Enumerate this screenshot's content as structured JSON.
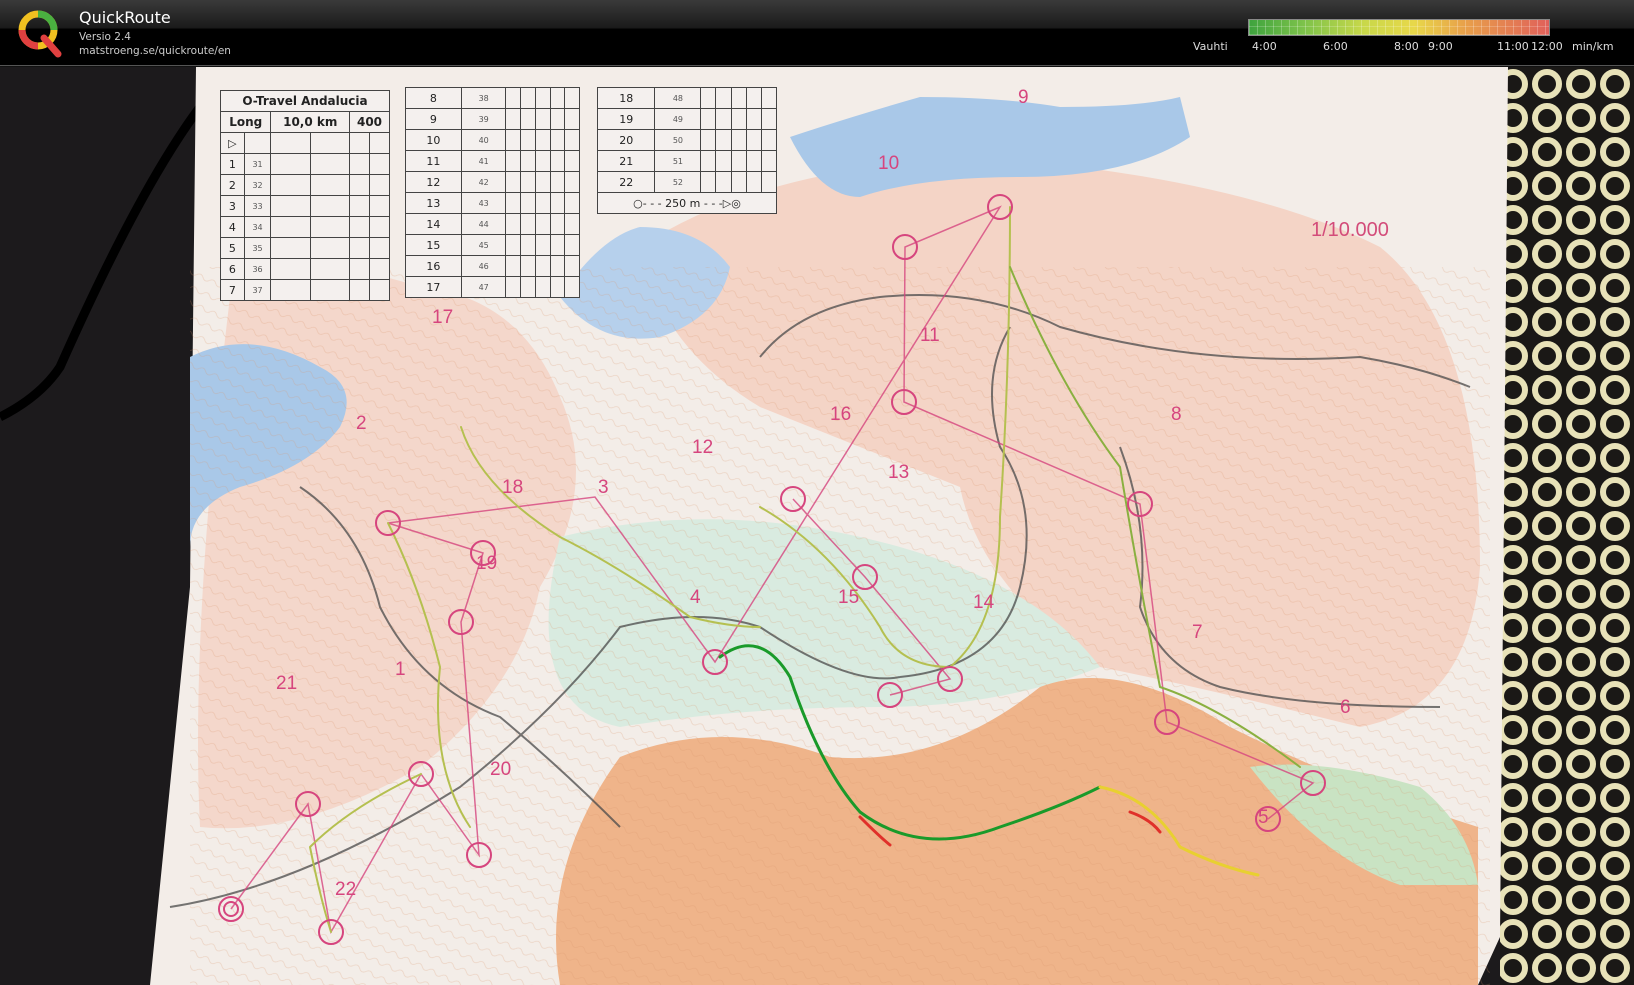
{
  "app": {
    "name": "QuickRoute",
    "version": "Versio 2.4",
    "url": "matstroeng.se/quickroute/en"
  },
  "legend": {
    "label": "Vauhti",
    "ticks": [
      "4:00",
      "6:00",
      "8:00",
      "9:00",
      "11:00",
      "12:00"
    ],
    "unit": "min/km",
    "colors": [
      "#3ea33e",
      "#7cc24a",
      "#c8d84a",
      "#e8d84a",
      "#e8a04a",
      "#e0605a"
    ]
  },
  "map": {
    "scale": "1/10.000",
    "event_title": "O-Travel Andalucia",
    "course": "Long",
    "distance": "10,0 km",
    "climb": "400",
    "route_colors": {
      "slow": "#e0302a",
      "medium": "#e8d030",
      "fast": "#1a9a2a"
    },
    "course_color": "#d6457e",
    "legend_distance": "250 m",
    "controls_table_1": [
      {
        "n": "1",
        "code": "31"
      },
      {
        "n": "2",
        "code": "32"
      },
      {
        "n": "3",
        "code": "33"
      },
      {
        "n": "4",
        "code": "34"
      },
      {
        "n": "5",
        "code": "35"
      },
      {
        "n": "6",
        "code": "36"
      },
      {
        "n": "7",
        "code": "37"
      }
    ],
    "controls_table_2": [
      {
        "n": "8",
        "code": "38"
      },
      {
        "n": "9",
        "code": "39"
      },
      {
        "n": "10",
        "code": "40"
      },
      {
        "n": "11",
        "code": "41"
      },
      {
        "n": "12",
        "code": "42"
      },
      {
        "n": "13",
        "code": "43"
      },
      {
        "n": "14",
        "code": "44"
      },
      {
        "n": "15",
        "code": "45"
      },
      {
        "n": "16",
        "code": "46"
      },
      {
        "n": "17",
        "code": "47"
      }
    ],
    "controls_table_3": [
      {
        "n": "18",
        "code": "48"
      },
      {
        "n": "19",
        "code": "49"
      },
      {
        "n": "20",
        "code": "50"
      },
      {
        "n": "21",
        "code": "51"
      },
      {
        "n": "22",
        "code": "52"
      }
    ],
    "control_labels": [
      "2",
      "3",
      "4",
      "5",
      "6",
      "7",
      "8",
      "9",
      "10",
      "11",
      "12",
      "13",
      "14",
      "15",
      "16",
      "17",
      "18",
      "19",
      "20",
      "21",
      "22",
      "1"
    ]
  }
}
